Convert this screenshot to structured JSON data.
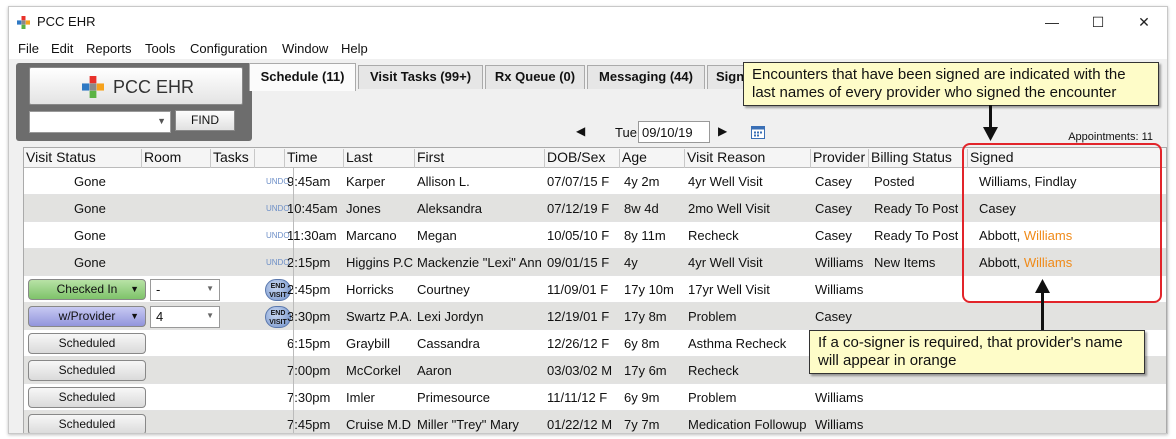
{
  "window": {
    "title": "PCC EHR",
    "minimize": "—",
    "maximize": "☐",
    "close": "✕"
  },
  "menu": [
    "File",
    "Edit",
    "Reports",
    "Tools",
    "Configuration",
    "Window",
    "Help"
  ],
  "logo": {
    "text": "PCC EHR",
    "find_label": "FIND",
    "search_value": ""
  },
  "tabs": [
    "Schedule (11)",
    "Visit Tasks (99+)",
    "Rx Queue (0)",
    "Messaging (44)",
    "Sign"
  ],
  "date_nav": {
    "day": "Tue",
    "date": "09/10/19",
    "appointments": "Appointments:  11"
  },
  "columns": [
    "Visit Status",
    "Room",
    "Tasks",
    "Time",
    "Last",
    "First",
    "DOB/Sex",
    "Age",
    "Visit Reason",
    "Provider",
    "Billing Status",
    "Signed"
  ],
  "rows": [
    {
      "status": "Gone",
      "status_type": "text",
      "room": "",
      "task": "UNDO",
      "time": "9:45am",
      "last": "Karper",
      "first": "Allison L.",
      "dob": "07/07/15 F",
      "age": "4y 2m",
      "reason": "4yr Well Visit",
      "provider": "Casey",
      "billing": "Posted",
      "signed": "Williams, Findlay",
      "signed_cosigner": ""
    },
    {
      "status": "Gone",
      "status_type": "text",
      "room": "",
      "task": "UNDO",
      "time": "10:45am",
      "last": "Jones",
      "first": "Aleksandra",
      "dob": "07/12/19 F",
      "age": "8w 4d",
      "reason": "2mo Well Visit",
      "provider": "Casey",
      "billing": "Ready To Post",
      "signed": "Casey",
      "signed_cosigner": ""
    },
    {
      "status": "Gone",
      "status_type": "text",
      "room": "",
      "task": "UNDO",
      "time": "11:30am",
      "last": "Marcano",
      "first": "Megan",
      "dob": "10/05/10 F",
      "age": "8y 11m",
      "reason": "Recheck",
      "provider": "Casey",
      "billing": "Ready To Post",
      "signed": "Abbott, ",
      "signed_cosigner": "Williams"
    },
    {
      "status": "Gone",
      "status_type": "text",
      "room": "",
      "task": "UNDO",
      "time": "2:15pm",
      "last": "Higgins P.C",
      "first": "Mackenzie \"Lexi\" Ann",
      "dob": "09/01/15 F",
      "age": "4y",
      "reason": "4yr Well Visit",
      "provider": "Williams",
      "billing": "New Items",
      "signed": "Abbott, ",
      "signed_cosigner": "Williams"
    },
    {
      "status": "Checked In",
      "status_type": "green",
      "room": "-",
      "task": "END VISIT",
      "time": "2:45pm",
      "last": "Horricks",
      "first": "Courtney",
      "dob": "11/09/01 F",
      "age": "17y 10m",
      "reason": "17yr Well Visit",
      "provider": "Williams",
      "billing": "",
      "signed": "",
      "signed_cosigner": ""
    },
    {
      "status": "w/Provider",
      "status_type": "purple",
      "room": "4",
      "task": "END VISIT",
      "time": "3:30pm",
      "last": "Swartz P.A.",
      "first": "Lexi Jordyn",
      "dob": "12/19/01 F",
      "age": "17y 8m",
      "reason": "Problem",
      "provider": "Casey",
      "billing": "",
      "signed": "",
      "signed_cosigner": ""
    },
    {
      "status": "Scheduled",
      "status_type": "gray",
      "room": "",
      "task": "",
      "time": "6:15pm",
      "last": "Graybill",
      "first": "Cassandra",
      "dob": "12/26/12 F",
      "age": "6y 8m",
      "reason": "Asthma Recheck",
      "provider": "",
      "billing": "",
      "signed": "",
      "signed_cosigner": ""
    },
    {
      "status": "Scheduled",
      "status_type": "gray",
      "room": "",
      "task": "",
      "time": "7:00pm",
      "last": "McCorkel",
      "first": "Aaron",
      "dob": "03/03/02 M",
      "age": "17y 6m",
      "reason": "Recheck",
      "provider": "",
      "billing": "",
      "signed": "",
      "signed_cosigner": ""
    },
    {
      "status": "Scheduled",
      "status_type": "gray",
      "room": "",
      "task": "",
      "time": "7:30pm",
      "last": "Imler",
      "first": "Primesource",
      "dob": "11/11/12 F",
      "age": "6y 9m",
      "reason": "Problem",
      "provider": "Williams",
      "billing": "",
      "signed": "",
      "signed_cosigner": ""
    },
    {
      "status": "Scheduled",
      "status_type": "gray",
      "room": "",
      "task": "",
      "time": "7:45pm",
      "last": "Cruise M.D",
      "first": "Miller \"Trey\" Mary",
      "dob": "01/22/12 M",
      "age": "7y 7m",
      "reason": "Medication Followup",
      "provider": "Williams",
      "billing": "",
      "signed": "",
      "signed_cosigner": ""
    }
  ],
  "callouts": {
    "top": "Encounters that have been signed are indicated with the last names of every provider who signed the encounter",
    "bottom": "If a co-signer is required, that provider's name will appear in orange"
  },
  "colors": {
    "cosigner": "#f08a18",
    "highlight": "#e2242a",
    "callout_bg": "#fefcc8"
  }
}
